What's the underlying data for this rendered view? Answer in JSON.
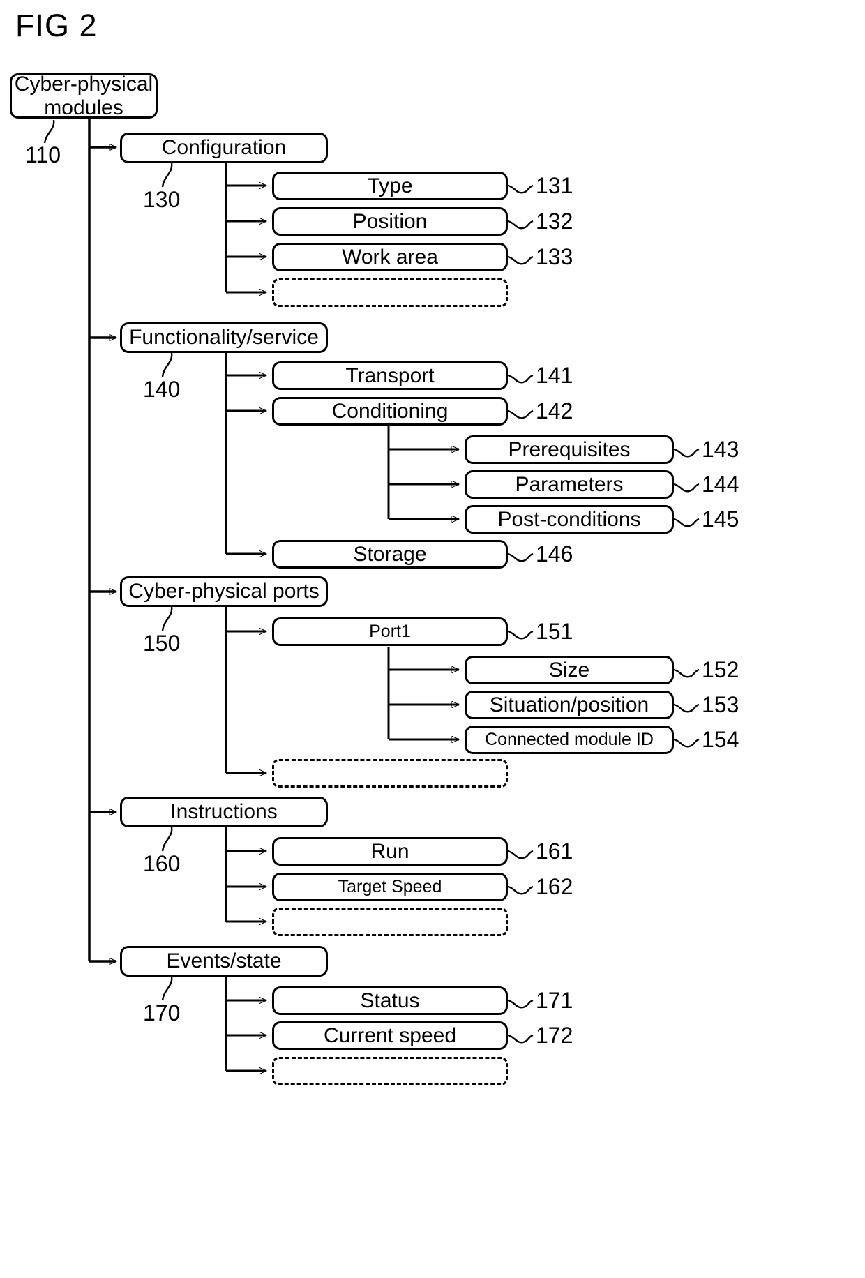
{
  "figure": {
    "label": "FIG 2"
  },
  "diagram": {
    "type": "hierarchy-tree",
    "root": {
      "id": "110",
      "label": "Cyber-physical\nmodules",
      "ref": "110"
    },
    "branches": [
      {
        "id": "130",
        "label": "Configuration",
        "ref": "130",
        "children": [
          {
            "id": "131",
            "label": "Type",
            "ref": "131",
            "style": "solid"
          },
          {
            "id": "132",
            "label": "Position",
            "ref": "132",
            "style": "solid"
          },
          {
            "id": "133",
            "label": "Work area",
            "ref": "133",
            "style": "solid"
          },
          {
            "id": "134",
            "label": "",
            "ref": "",
            "style": "dashed"
          }
        ]
      },
      {
        "id": "140",
        "label": "Functionality/service",
        "ref": "140",
        "children": [
          {
            "id": "141",
            "label": "Transport",
            "ref": "141",
            "style": "solid"
          },
          {
            "id": "142",
            "label": "Conditioning",
            "ref": "142",
            "style": "solid",
            "children": [
              {
                "id": "143",
                "label": "Prerequisites",
                "ref": "143",
                "style": "solid"
              },
              {
                "id": "144",
                "label": "Parameters",
                "ref": "144",
                "style": "solid"
              },
              {
                "id": "145",
                "label": "Post-conditions",
                "ref": "145",
                "style": "solid"
              }
            ]
          },
          {
            "id": "146",
            "label": "Storage",
            "ref": "146",
            "style": "solid"
          }
        ]
      },
      {
        "id": "150",
        "label": "Cyber-physical ports",
        "ref": "150",
        "children": [
          {
            "id": "151",
            "label": "Port1",
            "ref": "151",
            "style": "solid",
            "size": "small",
            "children": [
              {
                "id": "152",
                "label": "Size",
                "ref": "152",
                "style": "solid"
              },
              {
                "id": "153",
                "label": "Situation/position",
                "ref": "153",
                "style": "solid"
              },
              {
                "id": "154",
                "label": "Connected module ID",
                "ref": "154",
                "style": "solid"
              }
            ]
          },
          {
            "id": "155",
            "label": "",
            "ref": "",
            "style": "dashed"
          }
        ]
      },
      {
        "id": "160",
        "label": "Instructions",
        "ref": "160",
        "children": [
          {
            "id": "161",
            "label": "Run",
            "ref": "161",
            "style": "solid"
          },
          {
            "id": "162",
            "label": "Target Speed",
            "ref": "162",
            "style": "solid",
            "size": "small"
          },
          {
            "id": "163",
            "label": "",
            "ref": "",
            "style": "dashed"
          }
        ]
      },
      {
        "id": "170",
        "label": "Events/state",
        "ref": "170",
        "children": [
          {
            "id": "171",
            "label": "Status",
            "ref": "171",
            "style": "solid"
          },
          {
            "id": "172",
            "label": "Current speed",
            "ref": "172",
            "style": "solid"
          },
          {
            "id": "173",
            "label": "",
            "ref": "",
            "style": "dashed"
          }
        ]
      }
    ]
  },
  "nodes": {
    "root": {
      "label": "Cyber-physical\nmodules"
    },
    "configuration": {
      "label": "Configuration"
    },
    "type": {
      "label": "Type"
    },
    "position": {
      "label": "Position"
    },
    "work_area": {
      "label": "Work area"
    },
    "functionality": {
      "label": "Functionality/service"
    },
    "transport": {
      "label": "Transport"
    },
    "conditioning": {
      "label": "Conditioning"
    },
    "prerequisites": {
      "label": "Prerequisites"
    },
    "parameters": {
      "label": "Parameters"
    },
    "post_conditions": {
      "label": "Post-conditions"
    },
    "storage": {
      "label": "Storage"
    },
    "ports": {
      "label": "Cyber-physical ports"
    },
    "port1": {
      "label": "Port1"
    },
    "size": {
      "label": "Size"
    },
    "situation": {
      "label": "Situation/position"
    },
    "connected_id": {
      "label": "Connected module ID"
    },
    "instructions": {
      "label": "Instructions"
    },
    "run": {
      "label": "Run"
    },
    "target_speed": {
      "label": "Target Speed"
    },
    "events_state": {
      "label": "Events/state"
    },
    "status": {
      "label": "Status"
    },
    "current_speed": {
      "label": "Current speed"
    }
  },
  "refs": {
    "r110": "110",
    "r130": "130",
    "r131": "131",
    "r132": "132",
    "r133": "133",
    "r140": "140",
    "r141": "141",
    "r142": "142",
    "r143": "143",
    "r144": "144",
    "r145": "145",
    "r146": "146",
    "r150": "150",
    "r151": "151",
    "r152": "152",
    "r153": "153",
    "r154": "154",
    "r160": "160",
    "r161": "161",
    "r162": "162",
    "r170": "170",
    "r171": "171",
    "r172": "172"
  },
  "colors": {
    "ink": "#000000",
    "paper": "#ffffff"
  }
}
